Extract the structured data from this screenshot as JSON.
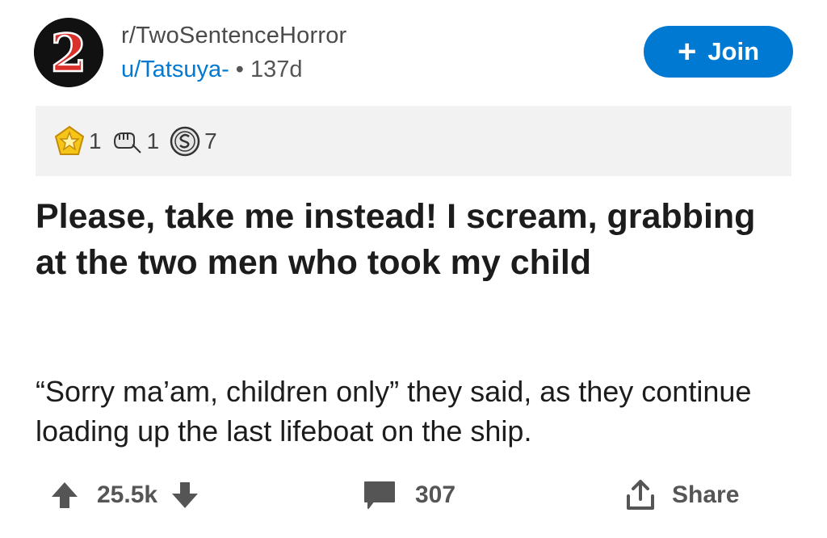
{
  "post": {
    "subreddit": "r/TwoSentenceHorror",
    "author": "u/Tatsuya-",
    "separator": "•",
    "age": "137d",
    "join_label": "Join",
    "title": "Please, take me instead! I scream, grabbing at the two men who took my child",
    "body": "“Sorry ma’am, children only” they said, as they continue loading up the last lifeboat on the ship."
  },
  "awards": [
    {
      "icon": "gold-star-award-icon",
      "count": "1"
    },
    {
      "icon": "fist-bump-award-icon",
      "count": "1"
    },
    {
      "icon": "silver-coin-award-icon",
      "count": "7"
    }
  ],
  "footer": {
    "score": "25.5k",
    "comments": "307",
    "share_label": "Share"
  },
  "avatar": {
    "glyph": "2"
  },
  "colors": {
    "accent": "#0079d3",
    "award_bar": "#f2f2f2",
    "avatar_bg": "#111111",
    "avatar_glyph": "#d9302b"
  }
}
